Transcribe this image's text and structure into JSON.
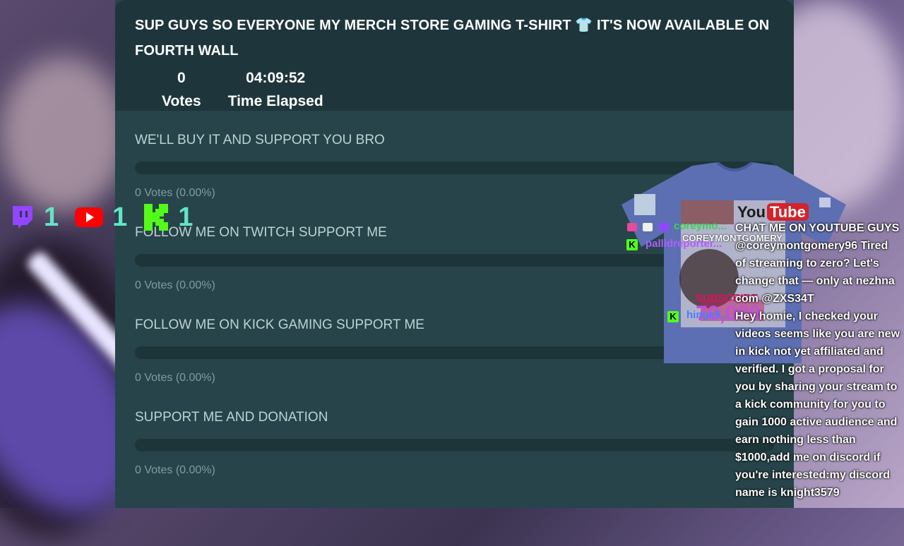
{
  "poll": {
    "title": "SUP GUYS SO EVERYONE MY MERCH STORE GAMING T-SHIRT 👕 IT'S NOW AVAILABLE ON FOURTH WALL",
    "votes_value": "0",
    "votes_label": "Votes",
    "time_value": "04:09:52",
    "time_label": "Time Elapsed",
    "options": [
      {
        "label": "WE'LL BUY IT AND SUPPORT YOU BRO",
        "votes": "0 Votes (0.00%)",
        "fraction": 0
      },
      {
        "label": "FOLLOW ME ON TWITCH SUPPORT ME",
        "votes": "0 Votes (0.00%)",
        "fraction": 0
      },
      {
        "label": "FOLLOW ME ON KICK GAMING SUPPORT ME",
        "votes": "0 Votes (0.00%)",
        "fraction": 0
      },
      {
        "label": "SUPPORT ME AND DONATION",
        "votes": "0 Votes (0.00%)",
        "fraction": 0
      }
    ]
  },
  "social": {
    "twitch_count": "1",
    "youtube_count": "1",
    "kick_count": "1"
  },
  "overlay": {
    "youtube_text": "You",
    "youtube_tube": "Tube",
    "shirt_text_1": "COREYMONTGOMERY",
    "shirt_text_2": "SUBSCRIBE",
    "shirt_text_3": "70,000"
  },
  "chat": {
    "users": [
      "coreymo...",
      "pallidreporter...",
      "hinge5..."
    ],
    "messages": [
      "CHAT ME ON YOUTUBE GUYS",
      "@coreymontgomery96 Tired of streaming to zero? Let's change that — only at nezhna com @ZXS34T",
      "Hey homie, I checked your videos seems like you are new in kick not yet affiliated and verified. I got a proposal for you by sharing your stream to a kick community for you to gain 1000 active audience and earn nothing less than $1000,add me on discord if you're interested:my discord name is knight3579"
    ]
  },
  "colors": {
    "panel_bg": "#264449",
    "header_bg": "#1e363b",
    "count_color": "#64e3c8",
    "kick_green": "#53fc18",
    "twitch_purple": "#9146ff",
    "youtube_red": "#ff0000"
  }
}
